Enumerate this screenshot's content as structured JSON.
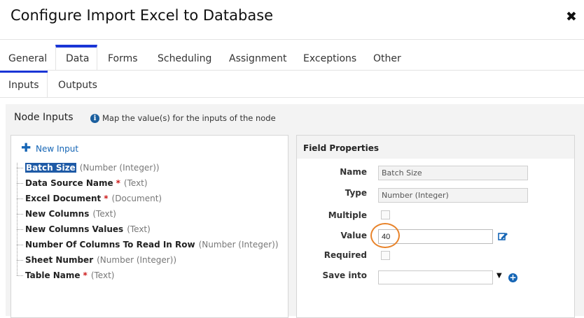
{
  "dialog": {
    "title": "Configure Import Excel to Database",
    "close_glyph": "✖"
  },
  "tabs": [
    {
      "label": "General"
    },
    {
      "label": "Data"
    },
    {
      "label": "Forms"
    },
    {
      "label": "Scheduling"
    },
    {
      "label": "Assignment"
    },
    {
      "label": "Exceptions"
    },
    {
      "label": "Other"
    }
  ],
  "active_tab": "Data",
  "subtabs": [
    {
      "label": "Inputs"
    },
    {
      "label": "Outputs"
    }
  ],
  "active_subtab": "Inputs",
  "node_inputs": {
    "title": "Node Inputs",
    "info_text": "Map the value(s) for the inputs of the node",
    "new_input_label": "New Input",
    "items": [
      {
        "name": "Batch Size",
        "required": "",
        "type": "(Number (Integer))",
        "selected": true
      },
      {
        "name": "Data Source Name",
        "required": "*",
        "type": "(Text)"
      },
      {
        "name": "Excel Document",
        "required": "*",
        "type": "(Document)"
      },
      {
        "name": "New Columns",
        "required": "",
        "type": "(Text)"
      },
      {
        "name": "New Columns Values",
        "required": "",
        "type": "(Text)"
      },
      {
        "name": "Number Of Columns To Read In Row",
        "required": "",
        "type": "(Number (Integer))"
      },
      {
        "name": "Sheet Number",
        "required": "",
        "type": "(Number (Integer))"
      },
      {
        "name": "Table Name",
        "required": "*",
        "type": "(Text)"
      }
    ]
  },
  "field_properties": {
    "title": "Field Properties",
    "name_label": "Name",
    "name_value": "Batch Size",
    "type_label": "Type",
    "type_value": "Number (Integer)",
    "multiple_label": "Multiple",
    "multiple_checked": false,
    "value_label": "Value",
    "value": "40",
    "required_label": "Required",
    "required_checked": false,
    "save_into_label": "Save into",
    "save_into_value": ""
  },
  "colors": {
    "accent": "#1a35d6",
    "link": "#1565b5",
    "selection": "#1e5aa6",
    "required": "#cc1a1a",
    "highlight_ring": "#e8832a"
  }
}
